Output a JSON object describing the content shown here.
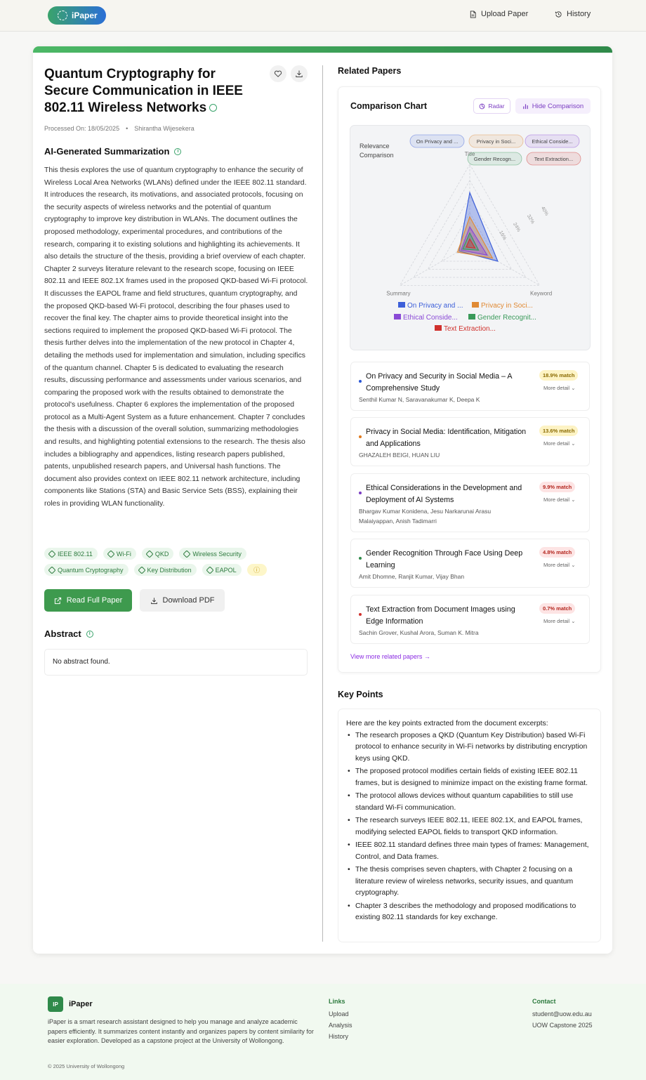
{
  "header": {
    "brand": "iPaper",
    "upload_label": "Upload Paper",
    "history_label": "History"
  },
  "paper": {
    "title": "Quantum Cryptography for Secure Communication in IEEE 802.11 Wireless Networks",
    "processed_on": "Processed On: 18/05/2025",
    "author": "Shirantha Wijesekera",
    "summary_heading": "AI-Generated Summarization",
    "summary": "This thesis explores the use of quantum cryptography to enhance the security of Wireless Local Area Networks (WLANs) defined under the IEEE 802.11 standard. It introduces the research, its motivations, and associated protocols, focusing on the security aspects of wireless networks and the potential of quantum cryptography to improve key distribution in WLANs. The document outlines the proposed methodology, experimental procedures, and contributions of the research, comparing it to existing solutions and highlighting its achievements. It also details the structure of the thesis, providing a brief overview of each chapter. Chapter 2 surveys literature relevant to the research scope, focusing on IEEE 802.11 and IEEE 802.1X frames used in the proposed QKD-based Wi-Fi protocol. It discusses the EAPOL frame and field structures, quantum cryptography, and the proposed QKD-based Wi-Fi protocol, describing the four phases used to recover the final key. The chapter aims to provide theoretical insight into the sections required to implement the proposed QKD-based Wi-Fi protocol. The thesis further delves into the implementation of the new protocol in Chapter 4, detailing the methods used for implementation and simulation, including specifics of the quantum channel. Chapter 5 is dedicated to evaluating the research results, discussing performance and assessments under various scenarios, and comparing the proposed work with the results obtained to demonstrate the protocol's usefulness. Chapter 6 explores the implementation of the proposed protocol as a Multi-Agent System as a future enhancement. Chapter 7 concludes the thesis with a discussion of the overall solution, summarizing methodologies and results, and highlighting potential extensions to the research. The thesis also includes a bibliography and appendices, listing research papers published, patents, unpublished research papers, and Universal hash functions. The document also provides context on IEEE 802.11 network architecture, including components like Stations (STA) and Basic Service Sets (BSS), explaining their roles in providing WLAN functionality.",
    "tags": [
      "IEEE 802.11",
      "Wi-Fi",
      "QKD",
      "Wireless Security",
      "Quantum Cryptography",
      "Key Distribution",
      "EAPOL"
    ],
    "read_button": "Read Full Paper",
    "download_button": "Download PDF",
    "abstract_heading": "Abstract",
    "abstract_text": "No abstract found."
  },
  "related": {
    "heading": "Related Papers",
    "chart_heading": "Comparison Chart",
    "radar_button": "Radar",
    "hide_button": "Hide Comparison",
    "view_more": "View more related papers →",
    "papers": [
      {
        "title": "On Privacy and Security in Social Media – A Comprehensive Study",
        "authors": "Senthil Kumar N, Saravanakumar K, Deepa K",
        "match": "18.9% match",
        "more": "More detail",
        "color": "#2a56d6",
        "badge_bg": "#fdf3c4",
        "badge_fg": "#8a6a00"
      },
      {
        "title": "Privacy in Social Media: Identification, Mitigation and Applications",
        "authors": "GHAZALEH BEIGI, HUAN LIU",
        "match": "13.6% match",
        "more": "More detail",
        "color": "#e07a1f",
        "badge_bg": "#fdf3c4",
        "badge_fg": "#8a6a00"
      },
      {
        "title": "Ethical Considerations in the Development and Deployment of AI Systems",
        "authors": "Bhargav Kumar Konidena, Jesu Narkarunai Arasu Malaiyappan, Anish Tadimarri",
        "match": "9.9% match",
        "more": "More detail",
        "color": "#7a3cc2",
        "badge_bg": "#fde4e4",
        "badge_fg": "#b3261e"
      },
      {
        "title": "Gender Recognition Through Face Using Deep Learning",
        "authors": "Amit Dhomne, Ranjit Kumar, Vijay Bhan",
        "match": "4.8% match",
        "more": "More detail",
        "color": "#2f8a4a",
        "badge_bg": "#fde4e4",
        "badge_fg": "#b3261e"
      },
      {
        "title": "Text Extraction from Document Images using Edge Information",
        "authors": "Sachin Grover, Kushal Arora, Suman K. Mitra",
        "match": "0.7% match",
        "more": "More detail",
        "color": "#d0312d",
        "badge_bg": "#fde4e4",
        "badge_fg": "#b3261e"
      }
    ]
  },
  "chart_data": {
    "type": "radar",
    "title": "Relevance Comparison",
    "axes": [
      "Title",
      "Keyword",
      "Summary"
    ],
    "ticks": [
      "16%",
      "24%",
      "32%",
      "40%"
    ],
    "range": [
      0,
      40
    ],
    "legend_position": "top-right",
    "chips": [
      "On Privacy and ...",
      "Privacy in Soci...",
      "Ethical Conside...",
      "Gender Recogn...",
      "Text Extraction..."
    ],
    "series": [
      {
        "name": "On Privacy and ...",
        "color": "#3d5fd9",
        "values": [
          26,
          16,
          6
        ]
      },
      {
        "name": "Privacy in Soci...",
        "color": "#e08a35",
        "values": [
          14,
          13,
          7
        ]
      },
      {
        "name": "Ethical Conside...",
        "color": "#8a4ad6",
        "values": [
          9,
          10,
          5
        ]
      },
      {
        "name": "Gender Recognit...",
        "color": "#3a9a5a",
        "values": [
          6,
          5,
          4
        ]
      },
      {
        "name": "Text Extraction...",
        "color": "#d0312d",
        "values": [
          3,
          3,
          2
        ]
      }
    ]
  },
  "key_points": {
    "heading": "Key Points",
    "intro": "Here are the key points extracted from the document excerpts:",
    "items": [
      "The research proposes a QKD (Quantum Key Distribution) based Wi-Fi protocol to enhance security in Wi-Fi networks by distributing encryption keys using QKD.",
      "The proposed protocol modifies certain fields of existing IEEE 802.11 frames, but is designed to minimize impact on the existing frame format.",
      "The protocol allows devices without quantum capabilities to still use standard Wi-Fi communication.",
      "The research surveys IEEE 802.11, IEEE 802.1X, and EAPOL frames, modifying selected EAPOL fields to transport QKD information.",
      "IEEE 802.11 standard defines three main types of frames: Management, Control, and Data frames.",
      "The thesis comprises seven chapters, with Chapter 2 focusing on a literature review of wireless networks, security issues, and quantum cryptography.",
      "Chapter 3 describes the methodology and proposed modifications to existing 802.11 standards for key exchange."
    ]
  },
  "footer": {
    "logo_text": "IP",
    "brand": "iPaper",
    "description": "iPaper is a smart research assistant designed to help you manage and analyze academic papers efficiently. It summarizes content instantly and organizes papers by content similarity for easier exploration. Developed as a capstone project at the University of Wollongong.",
    "copyright": "© 2025 University of Wollongong",
    "links_heading": "Links",
    "links": [
      "Upload",
      "Analysis",
      "History"
    ],
    "contact_heading": "Contact",
    "contact": [
      "student@uow.edu.au",
      "UOW Capstone 2025"
    ]
  }
}
